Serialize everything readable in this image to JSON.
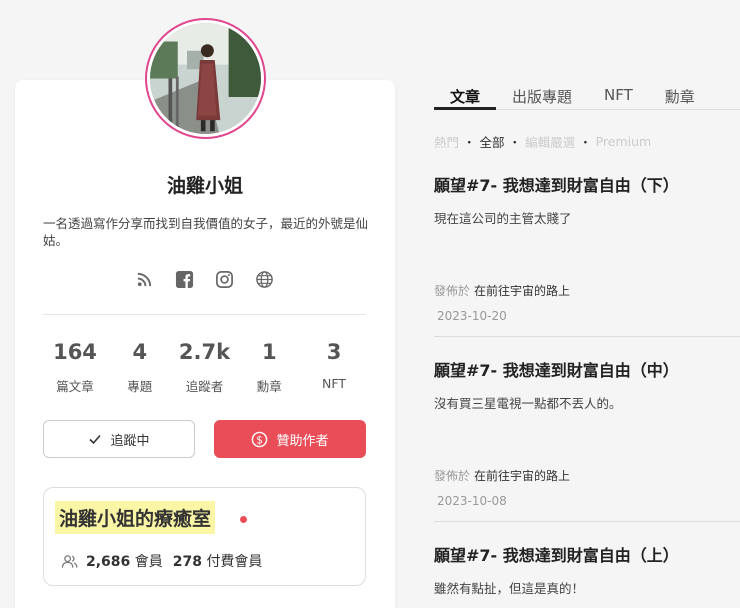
{
  "profile": {
    "name": "油雞小姐",
    "bio": "一名透過寫作分享而找到自我價值的女子，最近的外號是仙姑。",
    "ring_color": "#e0458d",
    "socials": [
      "rss-icon",
      "facebook-icon",
      "instagram-icon",
      "globe-icon"
    ],
    "stats": [
      {
        "value": "164",
        "label": "篇文章"
      },
      {
        "value": "4",
        "label": "專題"
      },
      {
        "value": "2.7k",
        "label": "追蹤者"
      },
      {
        "value": "1",
        "label": "勳章"
      },
      {
        "value": "3",
        "label": "NFT"
      }
    ],
    "follow_label": "追蹤中",
    "sponsor_label": "贊助作者",
    "accent": "#e94e58"
  },
  "publication": {
    "title": "油雞小姐的療癒室",
    "members_count": "2,686",
    "members_label": "會員",
    "paid_count": "278",
    "paid_label": "付費會員"
  },
  "tabs": [
    {
      "label": "文章",
      "active": true
    },
    {
      "label": "出版專題",
      "active": false
    },
    {
      "label": "NFT",
      "active": false
    },
    {
      "label": "勳章",
      "active": false
    }
  ],
  "filters": [
    {
      "label": "熱門",
      "active": false
    },
    {
      "label": "全部",
      "active": true
    },
    {
      "label": "編輯嚴選",
      "active": false
    },
    {
      "label": "Premium",
      "active": false
    }
  ],
  "posts": [
    {
      "title": "願望#7- 我想達到財富自由（下）",
      "desc": "現在這公司的主管太賤了",
      "meta_prefix": "發佈於",
      "publication": "在前往宇宙的路上",
      "date": "2023-10-20"
    },
    {
      "title": "願望#7- 我想達到財富自由（中）",
      "desc": "沒有買三星電視一點都不丟人的。",
      "meta_prefix": "發佈於",
      "publication": "在前往宇宙的路上",
      "date": "2023-10-08"
    },
    {
      "title": "願望#7- 我想達到財富自由（上）",
      "desc": "雖然有點扯，但這是真的！"
    }
  ]
}
